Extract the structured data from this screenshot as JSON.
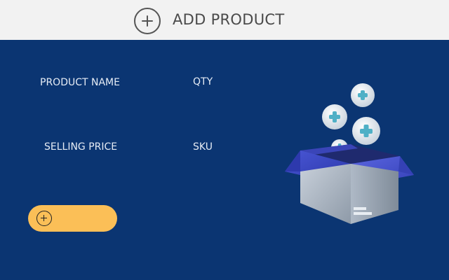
{
  "header": {
    "title": "ADD PRODUCT",
    "icon": "plus-circle-icon"
  },
  "form": {
    "product_name_label": "PRODUCT NAME",
    "qty_label": "QTY",
    "selling_price_label": "SELLING PRICE",
    "sku_label": "SKU"
  },
  "add_button": {
    "icon": "plus-circle-icon",
    "color": "#fbbf57"
  },
  "illustration": {
    "icon": "open-box-with-plus-icons"
  },
  "colors": {
    "background": "#0b3572",
    "header_background": "#f2f2f2",
    "accent": "#fbbf57",
    "label_text": "#e6ecf5"
  }
}
